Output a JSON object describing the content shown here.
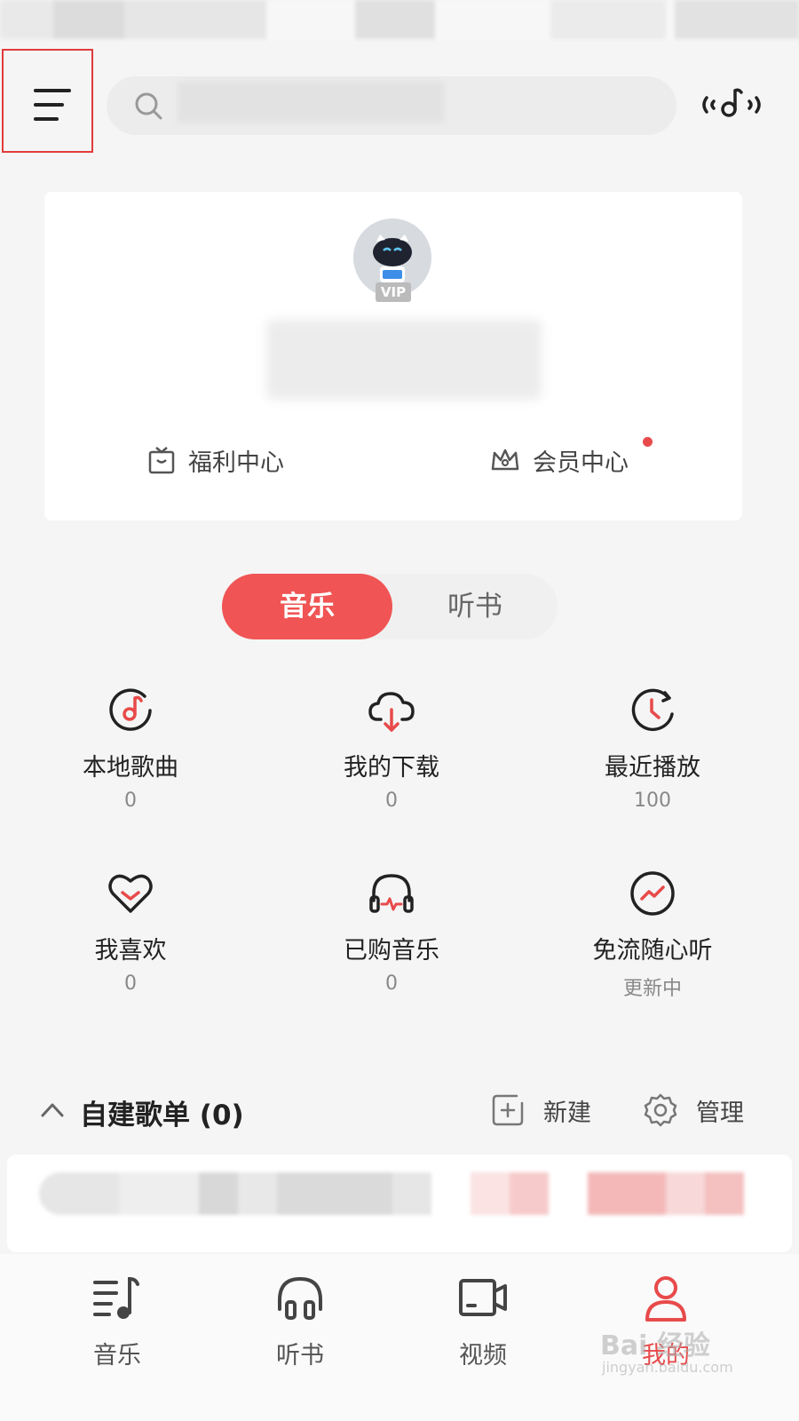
{
  "search": {
    "placeholder": ""
  },
  "profile": {
    "vip_badge": "VIP",
    "welfare_label": "福利中心",
    "member_label": "会员中心"
  },
  "segment": {
    "active": "音乐",
    "inactive": "听书"
  },
  "grid": [
    {
      "label": "本地歌曲",
      "count": "0",
      "icon": "music-disc-icon"
    },
    {
      "label": "我的下载",
      "count": "0",
      "icon": "cloud-download-icon"
    },
    {
      "label": "最近播放",
      "count": "100",
      "icon": "clock-icon"
    },
    {
      "label": "我喜欢",
      "count": "0",
      "icon": "heart-icon"
    },
    {
      "label": "已购音乐",
      "count": "0",
      "icon": "headphones-icon"
    },
    {
      "label": "免流随心听",
      "count": "更新中",
      "icon": "trend-icon"
    }
  ],
  "playlists": {
    "title": "自建歌单 (0)",
    "new_label": "新建",
    "manage_label": "管理"
  },
  "tabbar": [
    {
      "label": "音乐",
      "icon": "music-list-icon",
      "active": false
    },
    {
      "label": "听书",
      "icon": "headphones-icon",
      "active": false
    },
    {
      "label": "视频",
      "icon": "video-icon",
      "active": false
    },
    {
      "label": "我的",
      "icon": "profile-icon",
      "active": true
    }
  ],
  "watermark": {
    "brand": "Bai 经验",
    "url": "jingyan.baidu.com"
  },
  "colors": {
    "accent": "#f05454",
    "highlight_box": "#e23b3b"
  }
}
